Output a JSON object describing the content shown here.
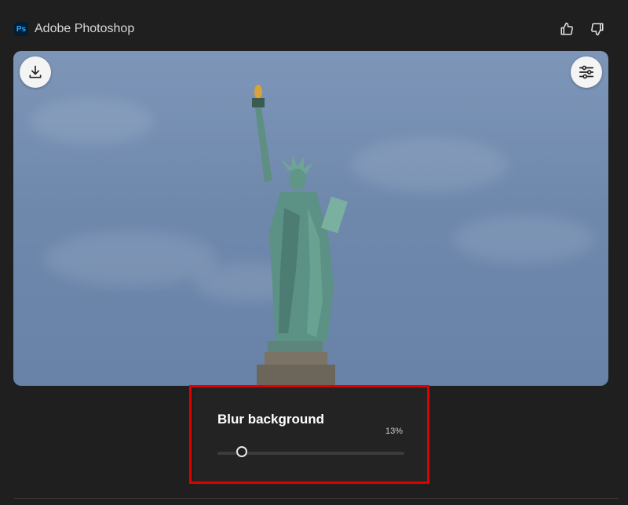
{
  "header": {
    "logo_text": "Ps",
    "app_name": "Adobe Photoshop",
    "icons": [
      "thumbs-up-icon",
      "thumbs-down-icon"
    ]
  },
  "image": {
    "subject": "Statue of Liberty",
    "buttons": [
      "download-icon",
      "adjust-icon"
    ]
  },
  "blur_panel": {
    "title": "Blur background",
    "value_label": "13%",
    "value": 13
  },
  "colors": {
    "background": "#1f1f1f",
    "panel": "#232323",
    "highlight": "#e00000",
    "logo_bg": "#001e36",
    "logo_text": "#31a8ff"
  }
}
